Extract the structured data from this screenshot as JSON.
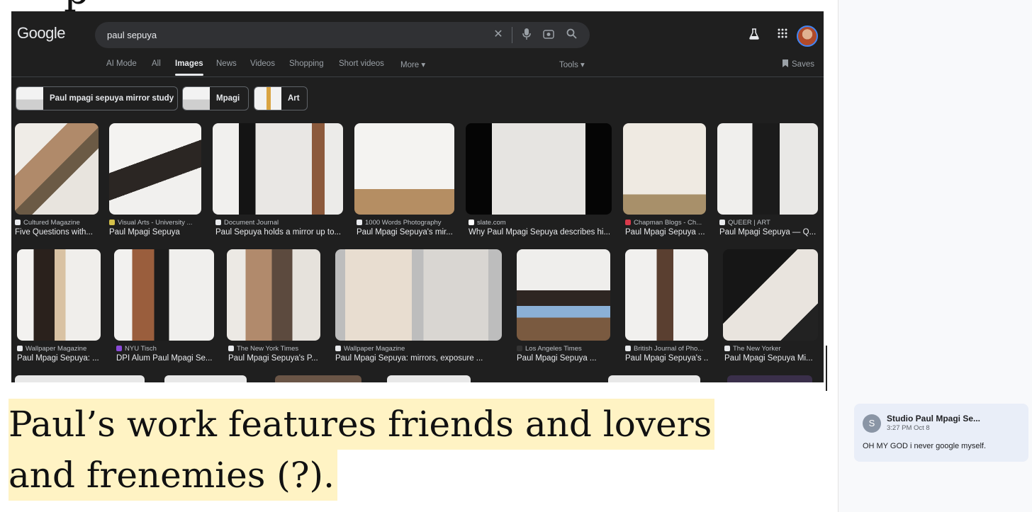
{
  "google": {
    "logo": "Google",
    "search_query": "paul sepuya",
    "tabs": [
      "AI Mode",
      "All",
      "Images",
      "News",
      "Videos",
      "Shopping",
      "Short videos",
      "More ▾",
      "Tools ▾",
      "Saves"
    ],
    "active_tab": "Images",
    "chips": [
      "Paul mpagi sepuya mirror study",
      "Mpagi",
      "Art"
    ],
    "row1": [
      {
        "source": "Cultured Magazine",
        "title": "Five Questions with..."
      },
      {
        "source": "Visual Arts - University ...",
        "title": "Paul Mpagi Sepuya"
      },
      {
        "source": "Document Journal",
        "title": "Paul Sepuya holds a mirror up to..."
      },
      {
        "source": "1000 Words Photography",
        "title": "Paul Mpagi Sepuya's mir..."
      },
      {
        "source": "slate.com",
        "title": "Why Paul Mpagi Sepuya describes hi..."
      },
      {
        "source": "Chapman Blogs - Ch...",
        "title": "Paul Mpagi Sepuya ..."
      },
      {
        "source": "QUEER | ART",
        "title": "Paul Mpagi Sepuya — Q..."
      }
    ],
    "row2": [
      {
        "source": "Wallpaper Magazine",
        "title": "Paul Mpagi Sepuya: ..."
      },
      {
        "source": "NYU Tisch",
        "title": "DPI Alum Paul Mpagi Se..."
      },
      {
        "source": "The New York Times",
        "title": "Paul Mpagi Sepuya's P..."
      },
      {
        "source": "Wallpaper Magazine",
        "title": "Paul Mpagi Sepuya: mirrors, exposure ..."
      },
      {
        "source": "Los Angeles Times",
        "title": "Paul Mpagi Sepuya ..."
      },
      {
        "source": "British Journal of Pho...",
        "title": "Paul Mpagi Sepuya's ..."
      },
      {
        "source": "The New Yorker",
        "title": "Paul Mpagi Sepuya Mi..."
      }
    ]
  },
  "caption": {
    "line1": "Paul’s work features friends and lovers",
    "line2": "and frenemies (?)."
  },
  "comment": {
    "avatar": "S",
    "author": "Studio Paul Mpagi Se...",
    "time": "3:27 PM Oct 8",
    "body": "OH MY GOD i never google myself."
  },
  "icons": [
    "close-icon",
    "mic-icon",
    "lens-icon",
    "search-icon",
    "labs-icon",
    "apps-grid-icon",
    "bookmark-icon"
  ],
  "colors": {
    "page_bg": "#1f1f1f",
    "highlight": "#fff3c4",
    "comment_bg": "#e9eef8"
  }
}
